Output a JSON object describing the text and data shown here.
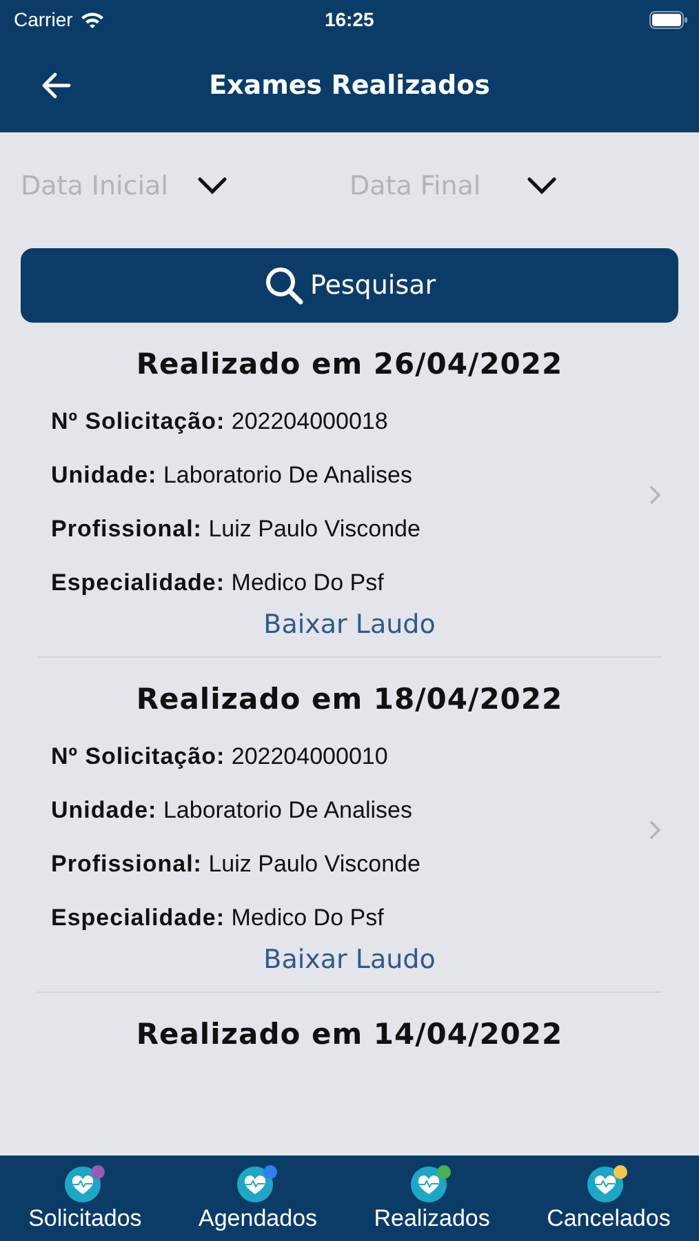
{
  "status_bar": {
    "carrier": "Carrier",
    "time": "16:25"
  },
  "nav": {
    "title": "Exames Realizados"
  },
  "filters": [
    {
      "placeholder": "Data Inicial"
    },
    {
      "placeholder": "Data Final"
    }
  ],
  "search_button": {
    "label": "Pesquisar"
  },
  "records": [
    {
      "title": "Realizado em 26/04/2022",
      "fields": [
        "**Nº Solicitação:** 202204000018",
        "**Unidade:** Laboratorio De Analises",
        "**Profissional:** Luiz Paulo Visconde",
        "**Especialidade:** Medico Do Psf"
      ],
      "link": "Baixar Laudo"
    },
    {
      "title": "Realizado em 18/04/2022",
      "fields": [
        "**Nº Solicitação:** 202204000010",
        "**Unidade:** Laboratorio De Analises",
        "**Profissional:** Luiz Paulo Visconde",
        "**Especialidade:** Medico Do Psf"
      ],
      "link": "Baixar Laudo"
    },
    {
      "title": "Realizado em 14/04/2022"
    }
  ],
  "tabs": [
    {
      "label": "Solicitados",
      "color": "#9b59b6"
    },
    {
      "label": "Agendados",
      "color": "#2f80ed"
    },
    {
      "label": "Realizados",
      "color": "#4caf50"
    },
    {
      "label": "Cancelados",
      "color": "#f2c94c"
    }
  ]
}
